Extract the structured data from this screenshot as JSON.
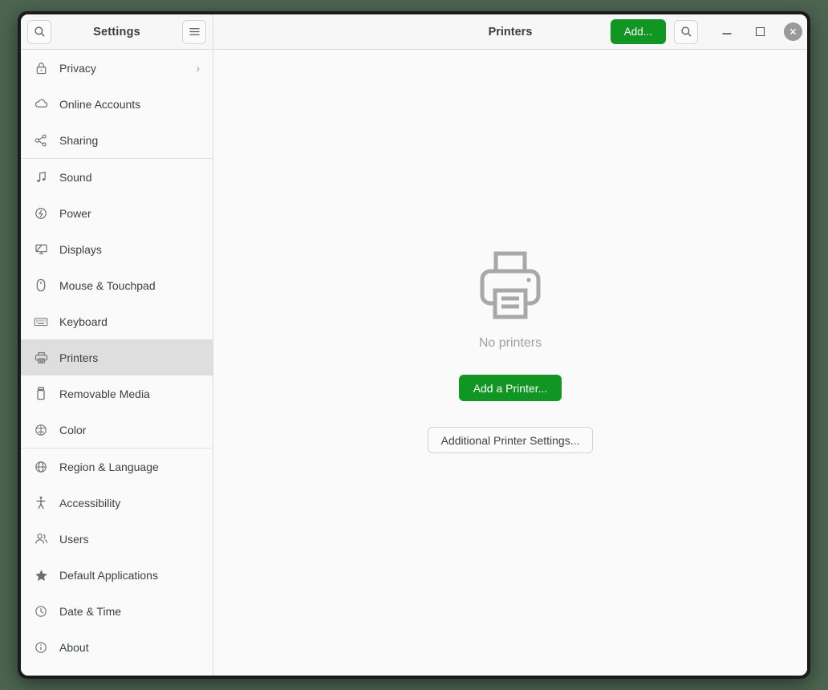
{
  "window": {
    "sidebar_title": "Settings",
    "content_title": "Printers",
    "search_icon": "search-icon",
    "menu_icon": "hamburger-menu-icon",
    "controls": {
      "minimize": "minimize-icon",
      "maximize": "maximize-icon",
      "close": "close-icon"
    }
  },
  "header": {
    "add_label": "Add...",
    "search_icon": "search-icon"
  },
  "sidebar": {
    "groups": [
      {
        "items": [
          {
            "label": "Privacy",
            "icon": "lock-icon",
            "chevron": "›",
            "selected": false
          },
          {
            "label": "Online Accounts",
            "icon": "cloud-icon",
            "selected": false
          },
          {
            "label": "Sharing",
            "icon": "share-nodes-icon",
            "selected": false
          }
        ]
      },
      {
        "items": [
          {
            "label": "Sound",
            "icon": "music-note-icon",
            "selected": false
          },
          {
            "label": "Power",
            "icon": "power-bolt-icon",
            "selected": false
          },
          {
            "label": "Displays",
            "icon": "monitor-icon",
            "selected": false
          },
          {
            "label": "Mouse & Touchpad",
            "icon": "mouse-icon",
            "selected": false
          },
          {
            "label": "Keyboard",
            "icon": "keyboard-icon",
            "selected": false
          },
          {
            "label": "Printers",
            "icon": "printer-icon",
            "selected": true
          },
          {
            "label": "Removable Media",
            "icon": "usb-drive-icon",
            "selected": false
          },
          {
            "label": "Color",
            "icon": "color-wheel-icon",
            "selected": false
          }
        ]
      },
      {
        "items": [
          {
            "label": "Region & Language",
            "icon": "globe-icon",
            "selected": false
          },
          {
            "label": "Accessibility",
            "icon": "accessibility-person-icon",
            "selected": false
          },
          {
            "label": "Users",
            "icon": "users-icon",
            "selected": false
          },
          {
            "label": "Default Applications",
            "icon": "star-icon",
            "selected": false
          },
          {
            "label": "Date & Time",
            "icon": "clock-icon",
            "selected": false
          },
          {
            "label": "About",
            "icon": "info-circle-icon",
            "selected": false
          }
        ]
      }
    ]
  },
  "content": {
    "empty_icon": "printer-large-icon",
    "empty_text": "No printers",
    "add_printer_label": "Add a Printer...",
    "additional_settings_label": "Additional Printer Settings..."
  },
  "colors": {
    "accent_green": "#119624",
    "desktop_background": "#4c6450",
    "selection": "#dedede",
    "panel": "#fafafa"
  }
}
